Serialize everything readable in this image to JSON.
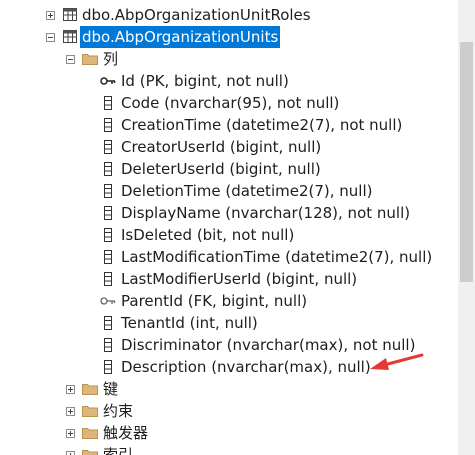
{
  "tree": {
    "table_roles": {
      "label": "dbo.AbpOrganizationUnitRoles",
      "icon": "table-icon"
    },
    "table_units": {
      "label": "dbo.AbpOrganizationUnits",
      "icon": "table-icon"
    },
    "columns_folder": {
      "label": "列",
      "icon": "folder-icon"
    },
    "columns": [
      {
        "label": "Id (PK, bigint, not null)",
        "icon": "primary-key-icon"
      },
      {
        "label": "Code (nvarchar(95), not null)",
        "icon": "column-icon"
      },
      {
        "label": "CreationTime (datetime2(7), not null)",
        "icon": "column-icon"
      },
      {
        "label": "CreatorUserId (bigint, null)",
        "icon": "column-icon"
      },
      {
        "label": "DeleterUserId (bigint, null)",
        "icon": "column-icon"
      },
      {
        "label": "DeletionTime (datetime2(7), null)",
        "icon": "column-icon"
      },
      {
        "label": "DisplayName (nvarchar(128), not null)",
        "icon": "column-icon"
      },
      {
        "label": "IsDeleted (bit, not null)",
        "icon": "column-icon"
      },
      {
        "label": "LastModificationTime (datetime2(7), null)",
        "icon": "column-icon"
      },
      {
        "label": "LastModifierUserId (bigint, null)",
        "icon": "column-icon"
      },
      {
        "label": "ParentId (FK, bigint, null)",
        "icon": "foreign-key-icon"
      },
      {
        "label": "TenantId (int, null)",
        "icon": "column-icon"
      },
      {
        "label": "Discriminator (nvarchar(max), not null)",
        "icon": "column-icon"
      },
      {
        "label": "Description (nvarchar(max), null)",
        "icon": "column-icon"
      }
    ],
    "folders": [
      {
        "label": "键",
        "icon": "folder-icon"
      },
      {
        "label": "约束",
        "icon": "folder-icon"
      },
      {
        "label": "触发器",
        "icon": "folder-icon"
      },
      {
        "label": "索引",
        "icon": "folder-icon"
      }
    ]
  },
  "colors": {
    "selection": "#0078d7",
    "folder": "#dcb67a",
    "annotation_arrow": "#e53935"
  }
}
